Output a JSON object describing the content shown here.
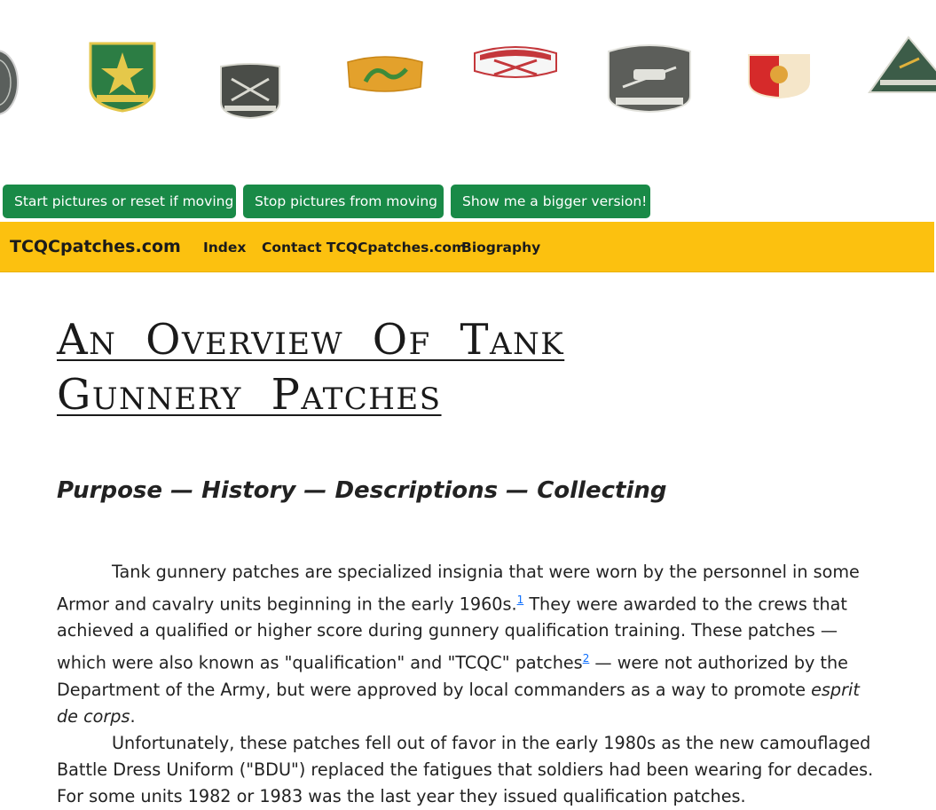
{
  "patches": [
    {
      "icon": "circle-patch-icon",
      "colors": {
        "fill": "#5a5f5c",
        "ink": "#d8d8d8"
      }
    },
    {
      "icon": "green-star-patch-icon",
      "colors": {
        "fill": "#2c7d44",
        "ink": "#e5c84a"
      }
    },
    {
      "icon": "gray-shield-patch-icon",
      "colors": {
        "fill": "#4a4d48",
        "ink": "#d9d9d0"
      }
    },
    {
      "icon": "orange-dragon-patch-icon",
      "colors": {
        "fill": "#e3a12c",
        "ink": "#3d8b3a"
      }
    },
    {
      "icon": "red-white-sabres-patch-icon",
      "colors": {
        "fill": "#f6f6f6",
        "ink": "#c4373b"
      }
    },
    {
      "icon": "gray-distinguished-patch-icon",
      "colors": {
        "fill": "#5c5e5a",
        "ink": "#e2e2dc"
      }
    },
    {
      "icon": "red-yellow-shield-patch-icon",
      "colors": {
        "fill": "#d62a2a",
        "ink": "#f5e6c9"
      }
    },
    {
      "icon": "green-triangle-patch-icon",
      "colors": {
        "fill": "#3c5c48",
        "ink": "#d9d9cf"
      }
    }
  ],
  "buttons": {
    "start": "Start pictures or reset if moving",
    "stop": "Stop pictures from moving",
    "bigger": "Show me a bigger version!"
  },
  "nav": {
    "brand": "TCQCpatches.com",
    "links": [
      "Index",
      "Contact TCQCpatches.com",
      "Biography"
    ]
  },
  "article": {
    "title": "An Overview Of Tank Gunnery Patches",
    "subtitle": "Purpose — History — Descriptions — Collecting",
    "p1": {
      "a": "Tank gunnery patches are specialized insignia that were worn by the personnel in some Armor and cavalry units beginning in the early 1960s.",
      "fn1": "1",
      "b": " They were awarded to the crews that achieved a qualified or higher score during gunnery qualification training. These patches — which were also known as \"qualification\" and \"TCQC\" patches",
      "fn2": "2",
      "c": " — were not authorized by the Department of the Army, but were approved by local commanders as a way to promote ",
      "em": "esprit de corps",
      "d": "."
    },
    "p2": "Unfortunately, these patches fell out of favor in the early 1980s as the new camouflaged Battle Dress Uniform (\"BDU\") replaced the fatigues that soldiers had been wearing for decades. For some units 1982 or 1983 was the last year they issued qualification patches."
  }
}
